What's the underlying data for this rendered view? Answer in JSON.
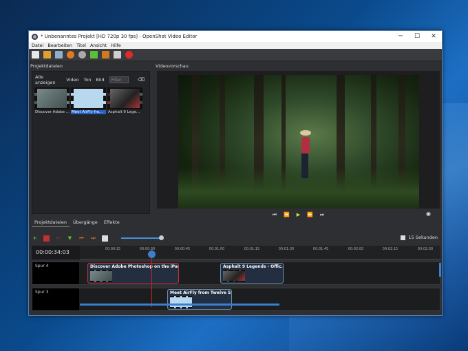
{
  "window": {
    "title": "* Unbenanntes Projekt [HD 720p 30 fps] - OpenShot Video Editor",
    "controls": [
      "─",
      "☐",
      "✕"
    ]
  },
  "menu": [
    "Datei",
    "Bearbeiten",
    "Titel",
    "Ansicht",
    "Hilfe"
  ],
  "project_panel": {
    "header": "Projektdateien",
    "filters": [
      "Alle anzeigen",
      "Video",
      "Ton",
      "Bild"
    ],
    "filter_placeholder": "Filter",
    "files": [
      {
        "label": "Discover Adobe ..."
      },
      {
        "label": "Meet AirFly fro..."
      },
      {
        "label": "Asphalt 9  Lege..."
      }
    ]
  },
  "preview_panel": {
    "header": "Videovorschau"
  },
  "playback": [
    "⏮",
    "⏪",
    "▶",
    "⏩",
    "⏭"
  ],
  "bottom_tabs": [
    "Projektdateien",
    "Übergänge",
    "Effekte"
  ],
  "timeline": {
    "seconds_label": "15 Sekunden",
    "timecode": "00:00:34:03",
    "ticks": [
      "00:00:15",
      "00:00:30",
      "00:00:45",
      "00:01:00",
      "00:01:15",
      "00:01:30",
      "00:01:45",
      "00:02:00",
      "00:02:15",
      "00:02:30"
    ],
    "tracks": [
      {
        "name": "Spur 4",
        "clips": [
          {
            "title": "Discover Adobe Photoshop on the iPad..."
          },
          {
            "title": "Asphalt 9 Legends - Offic..."
          }
        ]
      },
      {
        "name": "Spur 3",
        "clips": [
          {
            "title": "Meet AirFly from Twelve S..."
          }
        ]
      }
    ]
  },
  "colors": {
    "accent": "#3a7fd0",
    "play": "#c9e24a",
    "playhead": "#d02020"
  }
}
